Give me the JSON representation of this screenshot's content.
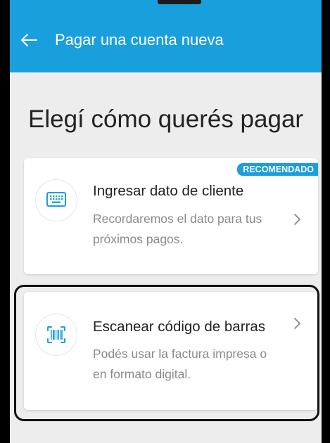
{
  "appbar": {
    "title": "Pagar una cuenta nueva",
    "back_icon": "arrow-left-icon",
    "color": "#1a9fdd"
  },
  "main": {
    "heading": "Elegí cómo querés pagar",
    "options": [
      {
        "badge": "RECOMENDADO",
        "icon": "keyboard-icon",
        "title": "Ingresar dato de cliente",
        "description": "Recordaremos el dato para tus próximos pagos."
      },
      {
        "icon": "barcode-scan-icon",
        "title": "Escanear código de barras",
        "description": "Podés usar la factura impresa o en formato digital."
      }
    ]
  }
}
